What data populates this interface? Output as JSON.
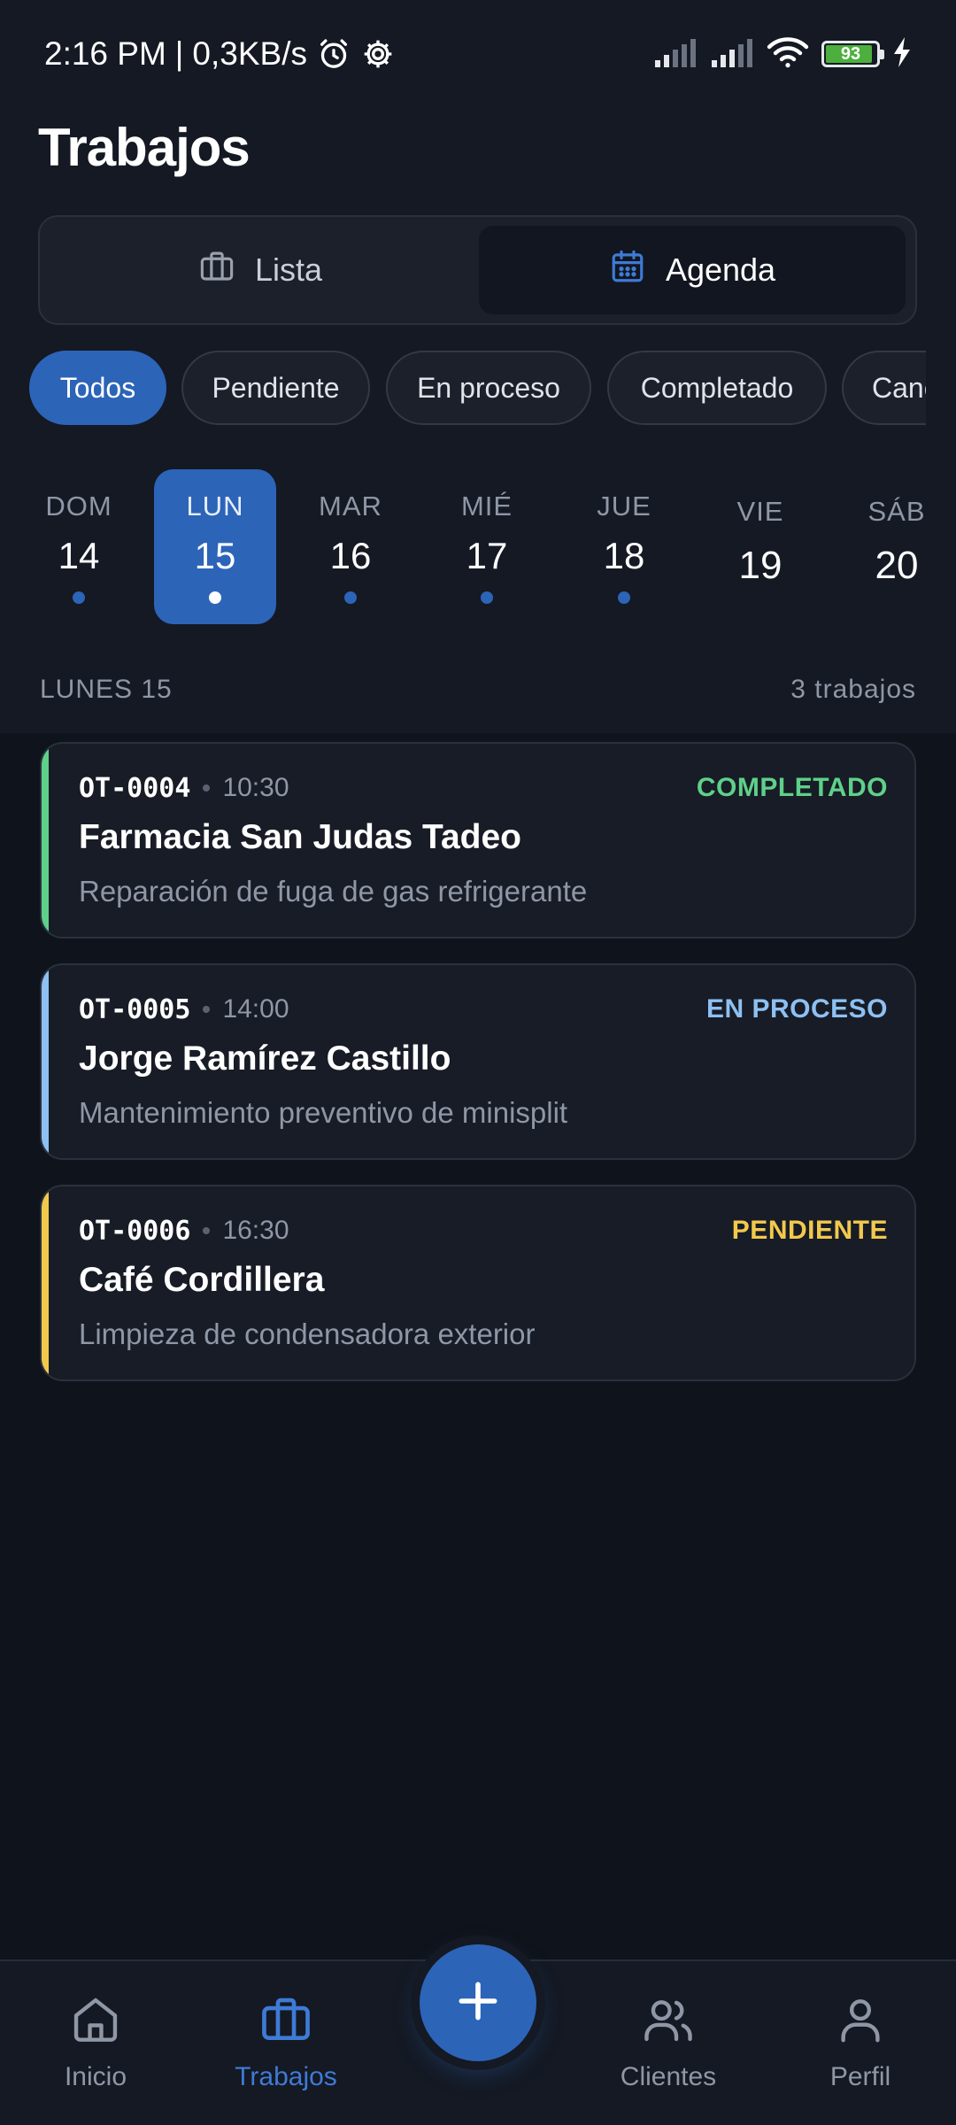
{
  "status_bar": {
    "time": "2:16 PM",
    "network_speed": "0,3KB/s",
    "battery_level": "93",
    "icons": [
      "alarm-icon",
      "settings-icon",
      "signal-icon",
      "signal-icon",
      "wifi-icon",
      "battery-icon",
      "charging-icon"
    ]
  },
  "page": {
    "title": "Trabajos"
  },
  "view_toggle": {
    "lista": "Lista",
    "agenda": "Agenda",
    "selected": "Agenda"
  },
  "filters": {
    "chips": [
      "Todos",
      "Pendiente",
      "En proceso",
      "Completado",
      "Cancelado"
    ],
    "selected": "Todos"
  },
  "week": {
    "days": [
      {
        "name": "DOM",
        "num": "14",
        "has_jobs": true
      },
      {
        "name": "LUN",
        "num": "15",
        "has_jobs": true,
        "selected": true
      },
      {
        "name": "MAR",
        "num": "16",
        "has_jobs": true
      },
      {
        "name": "MIÉ",
        "num": "17",
        "has_jobs": true
      },
      {
        "name": "JUE",
        "num": "18",
        "has_jobs": true
      },
      {
        "name": "VIE",
        "num": "19",
        "has_jobs": false
      },
      {
        "name": "SÁB",
        "num": "20",
        "has_jobs": false
      }
    ]
  },
  "section": {
    "title": "LUNES 15",
    "count": "3 trabajos"
  },
  "jobs": [
    {
      "code": "OT-0004",
      "time": "10:30",
      "status": "COMPLETADO",
      "client": "Farmacia San Judas Tadeo",
      "description": "Reparación de fuga de gas refrigerante",
      "color": "#5fd08a"
    },
    {
      "code": "OT-0005",
      "time": "14:00",
      "status": "EN PROCESO",
      "client": "Jorge Ramírez Castillo",
      "description": "Mantenimiento preventivo de minisplit",
      "color": "#8ec0f2"
    },
    {
      "code": "OT-0006",
      "time": "16:30",
      "status": "PENDIENTE",
      "client": "Café Cordillera",
      "description": "Limpieza de condensadora exterior",
      "color": "#f2c94c"
    }
  ],
  "bottom_nav": {
    "items": [
      {
        "label": "Inicio",
        "icon": "home-icon"
      },
      {
        "label": "Trabajos",
        "icon": "briefcase-icon",
        "active": true
      },
      {
        "label": "Clientes",
        "icon": "users-icon"
      },
      {
        "label": "Perfil",
        "icon": "user-icon"
      }
    ],
    "fab_icon": "plus-icon"
  },
  "colors": {
    "accent": "#2c64b8",
    "background": "#0f131b",
    "surface": "#171c26",
    "muted_text": "#8f97a6",
    "completed": "#5fd08a",
    "in_progress": "#8ec0f2",
    "pending": "#f2c94c"
  }
}
